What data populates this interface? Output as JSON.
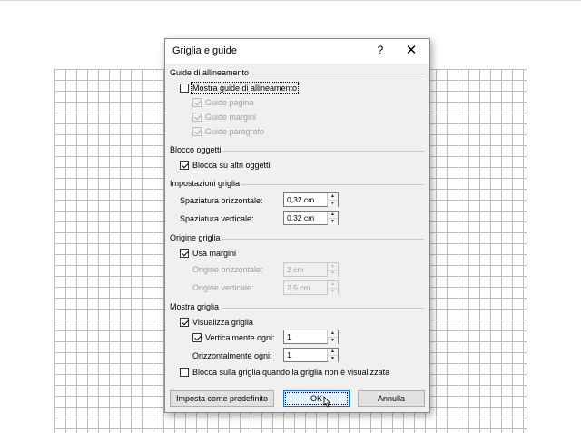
{
  "dialog": {
    "title": "Griglia e guide",
    "help": "?",
    "close": "✕"
  },
  "guide": {
    "heading": "Guide di allineamento",
    "show_label": "Mostra guide di allineamento",
    "show_checked": false,
    "page_label": "Guide pagina",
    "margins_label": "Guide margini",
    "paragraph_label": "Guide paragrafo"
  },
  "objects": {
    "heading": "Blocco oggetti",
    "lock_label": "Blocca su altri oggetti",
    "lock_checked": true
  },
  "settings": {
    "heading": "Impostazioni griglia",
    "horizontal_label": "Spaziatura orizzontale:",
    "horizontal_value": "0,32 cm",
    "vertical_label": "Spaziatura verticale:",
    "vertical_value": "0,32 cm"
  },
  "origin": {
    "heading": "Origine griglia",
    "use_margins_label": "Usa margini",
    "use_margins_checked": true,
    "horizontal_label": "Origine orizzontale:",
    "horizontal_value": "2 cm",
    "vertical_label": "Origine verticale:",
    "vertical_value": "2,5 cm"
  },
  "show_grid": {
    "heading": "Mostra griglia",
    "visualize_label": "Visualizza griglia",
    "visualize_checked": true,
    "vertical_every_label": "Verticalmente ogni:",
    "vertical_every_checked": true,
    "vertical_every_value": "1",
    "horizontal_every_label": "Orizzontalmente ogni:",
    "horizontal_every_value": "1",
    "lock_hidden_label": "Blocca sulla griglia quando la griglia non è visualizzata",
    "lock_hidden_checked": false
  },
  "buttons": {
    "default_label": "Imposta come predefinito",
    "ok_label": "OK",
    "cancel_label": "Annulla"
  },
  "icons": {
    "spin_up": "▲",
    "spin_down": "▼"
  }
}
